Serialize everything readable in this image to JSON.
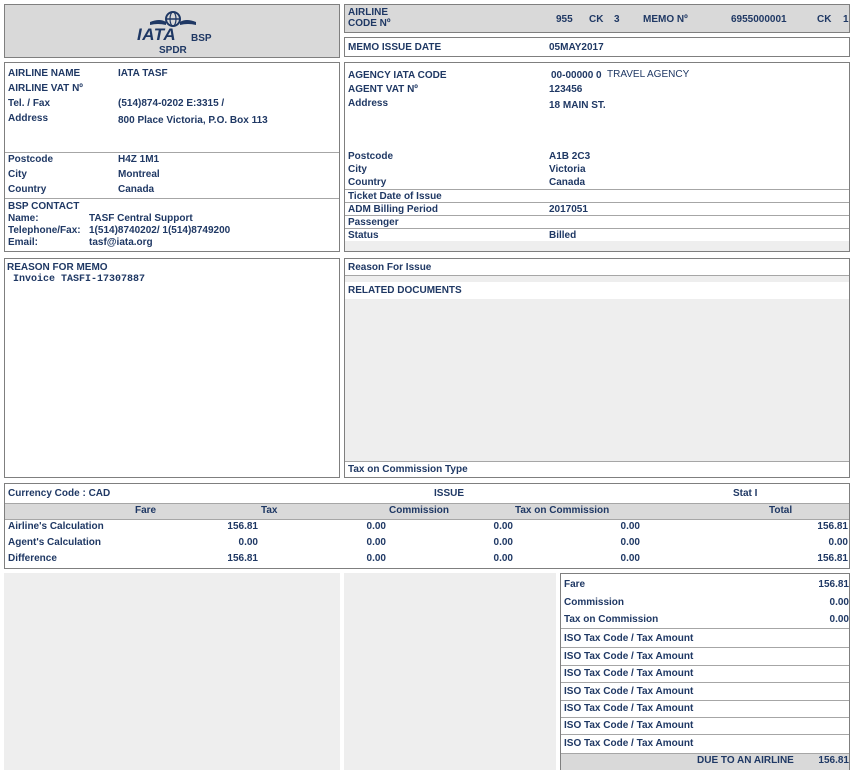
{
  "logo": {
    "text": "IATA",
    "bsp": "BSP",
    "spdr": "SPDR"
  },
  "header": {
    "airline_code_label_1": "AIRLINE",
    "airline_code_label_2": "CODE Nº",
    "airline_code": "955",
    "ck_label": "CK",
    "ck_value": "3",
    "memo_no_label": "MEMO Nº",
    "memo_no": "6955000001",
    "ck2_label": "CK",
    "ck2_value": "1"
  },
  "memo_issue": {
    "label": "MEMO ISSUE DATE",
    "value": "05MAY2017"
  },
  "airline": {
    "name_label": "AIRLINE NAME",
    "name": "IATA TASF",
    "vat_label": "AIRLINE VAT Nº",
    "vat": "",
    "tel_label": "Tel. / Fax",
    "tel": "(514)874-0202 E:3315 /",
    "address_label": "Address",
    "address": "800 Place Victoria, P.O. Box 113",
    "postcode_label": "Postcode",
    "postcode": "H4Z 1M1",
    "city_label": "City",
    "city": "Montreal",
    "country_label": "Country",
    "country": "Canada"
  },
  "bsp_contact": {
    "title": "BSP CONTACT",
    "name_label": "Name:",
    "name": "TASF Central Support",
    "tel_label": "Telephone/Fax:",
    "tel": "1(514)8740202/ 1(514)8749200",
    "email_label": "Email:",
    "email": "tasf@iata.org"
  },
  "agency": {
    "code_label": "AGENCY IATA CODE",
    "code": "00-00000 0",
    "agency_name": "TRAVEL AGENCY",
    "vat_label": "AGENT VAT Nº",
    "vat": "123456",
    "address_label": "Address",
    "address": "18 MAIN ST.",
    "postcode_label": "Postcode",
    "postcode": "A1B 2C3",
    "city_label": "City",
    "city": "Victoria",
    "country_label": "Country",
    "country": "Canada",
    "ticket_date_label": "Ticket Date of Issue",
    "ticket_date": "",
    "billing_label": "ADM Billing Period",
    "billing": "2017051",
    "passenger_label": "Passenger",
    "passenger": "",
    "status_label": "Status",
    "status": "Billed"
  },
  "reason": {
    "label": "REASON FOR MEMO",
    "text": "Invoice TASFI-17307887"
  },
  "reason_issue": {
    "label": "Reason For Issue"
  },
  "related": {
    "label": "RELATED DOCUMENTS"
  },
  "tax_commission_type": {
    "label": "Tax on Commission Type"
  },
  "calc": {
    "currency": "Currency Code : CAD",
    "issue": "ISSUE",
    "stat": "Stat  I",
    "headers": [
      "Fare",
      "Tax",
      "Commission",
      "Tax on Commission",
      "Total"
    ],
    "rows": [
      {
        "label": "Airline's Calculation",
        "values": [
          "156.81",
          "0.00",
          "0.00",
          "0.00",
          "156.81"
        ]
      },
      {
        "label": "Agent's Calculation",
        "values": [
          "0.00",
          "0.00",
          "0.00",
          "0.00",
          "0.00"
        ]
      },
      {
        "label": "Difference",
        "values": [
          "156.81",
          "0.00",
          "0.00",
          "0.00",
          "156.81"
        ]
      }
    ]
  },
  "summary": {
    "fare_label": "Fare",
    "fare": "156.81",
    "commission_label": "Commission",
    "commission": "0.00",
    "tax_comm_label": "Tax on Commission",
    "tax_comm": "0.00",
    "iso_rows": [
      "ISO Tax Code / Tax Amount",
      "ISO Tax Code / Tax Amount",
      "ISO Tax Code / Tax Amount",
      "ISO Tax Code / Tax Amount",
      "ISO Tax Code / Tax Amount",
      "ISO Tax Code / Tax Amount",
      "ISO Tax Code / Tax Amount"
    ],
    "due_label": "DUE TO AN AIRLINE",
    "due": "156.81"
  },
  "colors": {
    "text": "#1f3864",
    "panel_grey": "#d9d9d9",
    "light_grey": "#eeeeee",
    "logo_blue": "#1f3864"
  }
}
